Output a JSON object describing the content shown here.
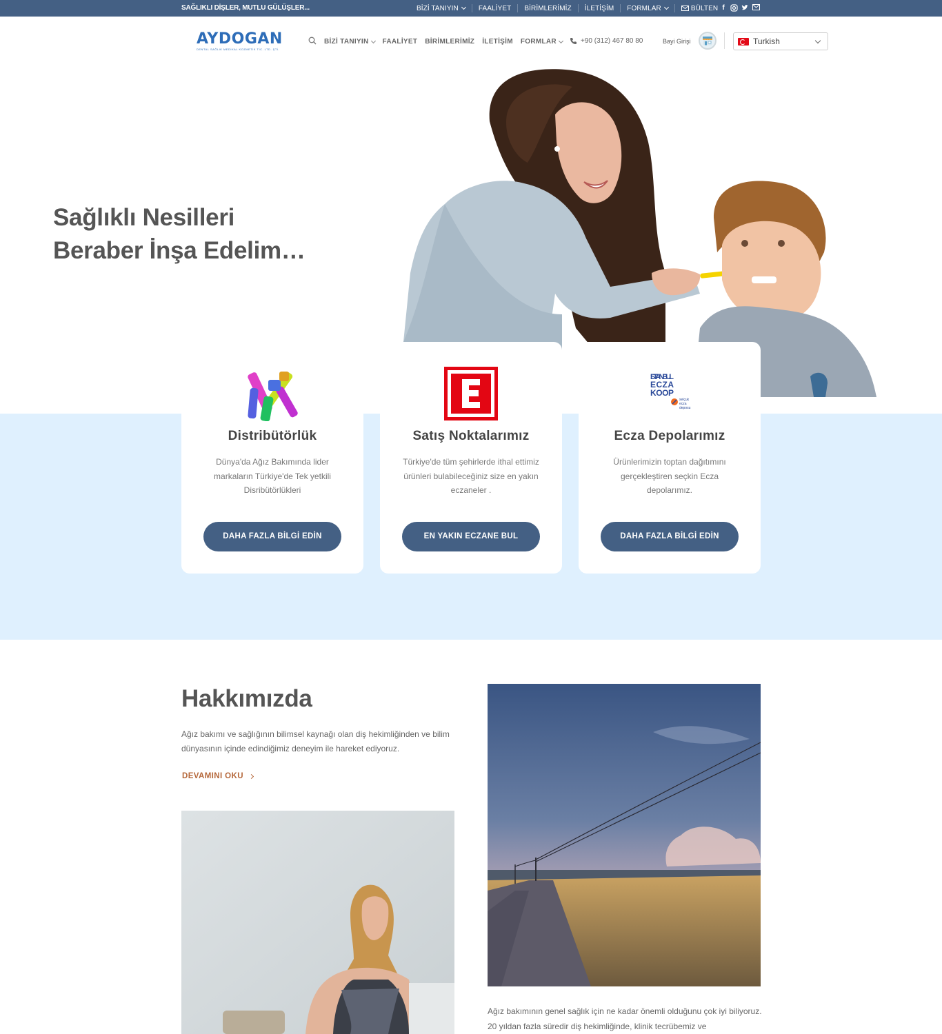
{
  "topbar": {
    "tagline": "SAĞLIKLI DİŞLER, MUTLU GÜLÜŞLER...",
    "nav": [
      {
        "label": "BİZİ TANIYIN",
        "has_dropdown": true
      },
      {
        "label": "FAALİYET",
        "has_dropdown": false
      },
      {
        "label": "BİRİMLERİMİZ",
        "has_dropdown": false
      },
      {
        "label": "İLETİŞİM",
        "has_dropdown": false
      },
      {
        "label": "FORMLAR",
        "has_dropdown": true
      },
      {
        "label": "BÜLTEN",
        "has_dropdown": false,
        "icon": "envelope-icon"
      }
    ],
    "social": [
      "facebook-icon",
      "instagram-icon",
      "twitter-icon",
      "email-icon"
    ],
    "background": "#446084"
  },
  "header": {
    "logo": {
      "title": "AYDOGAN",
      "subtitle": "DENTAL SAĞLIK MEDİKAL KOZMETİK TİC. LTD. ŞTİ."
    },
    "nav": [
      {
        "label": "BİZİ TANIYIN",
        "has_dropdown": true
      },
      {
        "label": "FAALİYET",
        "has_dropdown": false
      },
      {
        "label": "BİRİMLERİMİZ",
        "has_dropdown": false
      },
      {
        "label": "İLETİŞİM",
        "has_dropdown": false
      },
      {
        "label": "FORMLAR",
        "has_dropdown": true
      }
    ],
    "phone": "+90 (312) 467 80 80",
    "dealer_login": "Bayi Girişi",
    "language": "Turkish"
  },
  "hero": {
    "title_line1": "Sağlıklı Nesilleri",
    "title_line2": "Beraber İnşa Edelim…"
  },
  "services": [
    {
      "title": "Distribütörlük",
      "text": "Dünya'da Ağız Bakımında lider markaların Türkiye'de Tek yetkili Disribütörlükleri",
      "button": "DAHA FAZLA BİLGİ EDİN",
      "icon": "toothbrushes-icon"
    },
    {
      "title": "Satış Noktalarımız",
      "text": "Türkiye'de tüm şehirlerde ithal ettimiz ürünleri bulabileceğiniz size en yakın eczaneler .",
      "button": "EN YAKIN ECZANE BUL",
      "icon": "pharmacy-e-icon"
    },
    {
      "title": "Ecza Depolarımız",
      "text": "Ürünlerimizin toptan dağıtımını gerçekleştiren seçkin Ecza depolarımız.",
      "button": "DAHA FAZLA BİLGİ EDİN",
      "icon": "istanbul-ecza-koop-logo",
      "logo_text": [
        "ISTANBUL",
        "ECZA",
        "KOOP",
        "selçuk",
        "ecza",
        "deposu"
      ]
    }
  ],
  "about": {
    "title": "Hakkımızda",
    "text": "Ağız bakımı ve sağlığının bilimsel kaynağı olan diş hekimliğinden ve bilim dünyasının içinde edindiğimiz deneyim ile hareket ediyoruz.",
    "read_more": "DEVAMINI OKU",
    "text2": "Ağız bakımının genel sağlık için ne kadar önemli olduğunu çok iyi biliyoruz. 20 yıldan fazla süredir diş hekimliğinde, klinik tecrübemiz ve"
  },
  "colors": {
    "primary": "#446084",
    "band": "#dff0fe",
    "link_accent": "#b5673a",
    "logo_blue": "#2e6db8",
    "pharmacy_red": "#e30613"
  }
}
